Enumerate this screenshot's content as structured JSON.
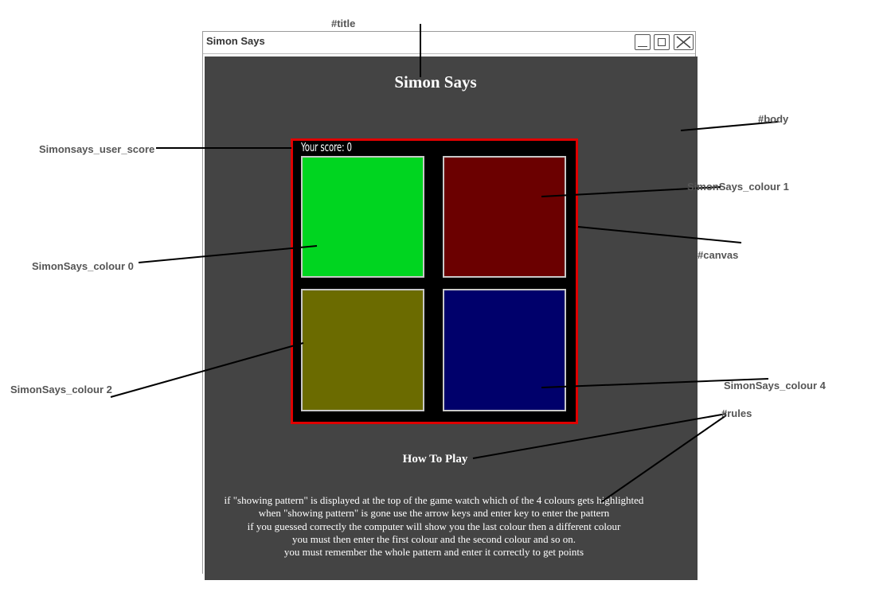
{
  "window": {
    "title": "Simon Says"
  },
  "app": {
    "title": "Simon Says",
    "score_text": "Your score: 0",
    "tiles": [
      {
        "id": "SimonSays_colour 0",
        "color": "#00d520"
      },
      {
        "id": "SimonSays_colour 1",
        "color": "#6b0000"
      },
      {
        "id": "SimonSays_colour 2",
        "color": "#6b6b00"
      },
      {
        "id": "SimonSays_colour 4",
        "color": "#00006b"
      }
    ],
    "canvas_border_color": "#e00000",
    "body_color": "#444444",
    "how_to_play": "How To Play",
    "rules": [
      "if \"showing pattern\" is displayed at the top of the game watch which of the 4 colours gets highlighted",
      "when \"showing pattern\" is gone use the arrow keys and enter key to enter the pattern",
      "if you guessed correctly the computer will show you the last colour then a different colour",
      "you must then enter the first colour and the second colour and so on.",
      "you must remember the whole pattern and enter it correctly to get points"
    ]
  },
  "annotations": {
    "title": "#title",
    "body": "#body",
    "user_score": "Simonsays_user_score",
    "colour_1": "SimonSays_colour 1",
    "canvas": "#canvas",
    "colour_0": "SimonSays_colour 0",
    "colour_2": "SimonSays_colour 2",
    "colour_4": "SimonSays_colour 4",
    "rules": "#rules"
  }
}
